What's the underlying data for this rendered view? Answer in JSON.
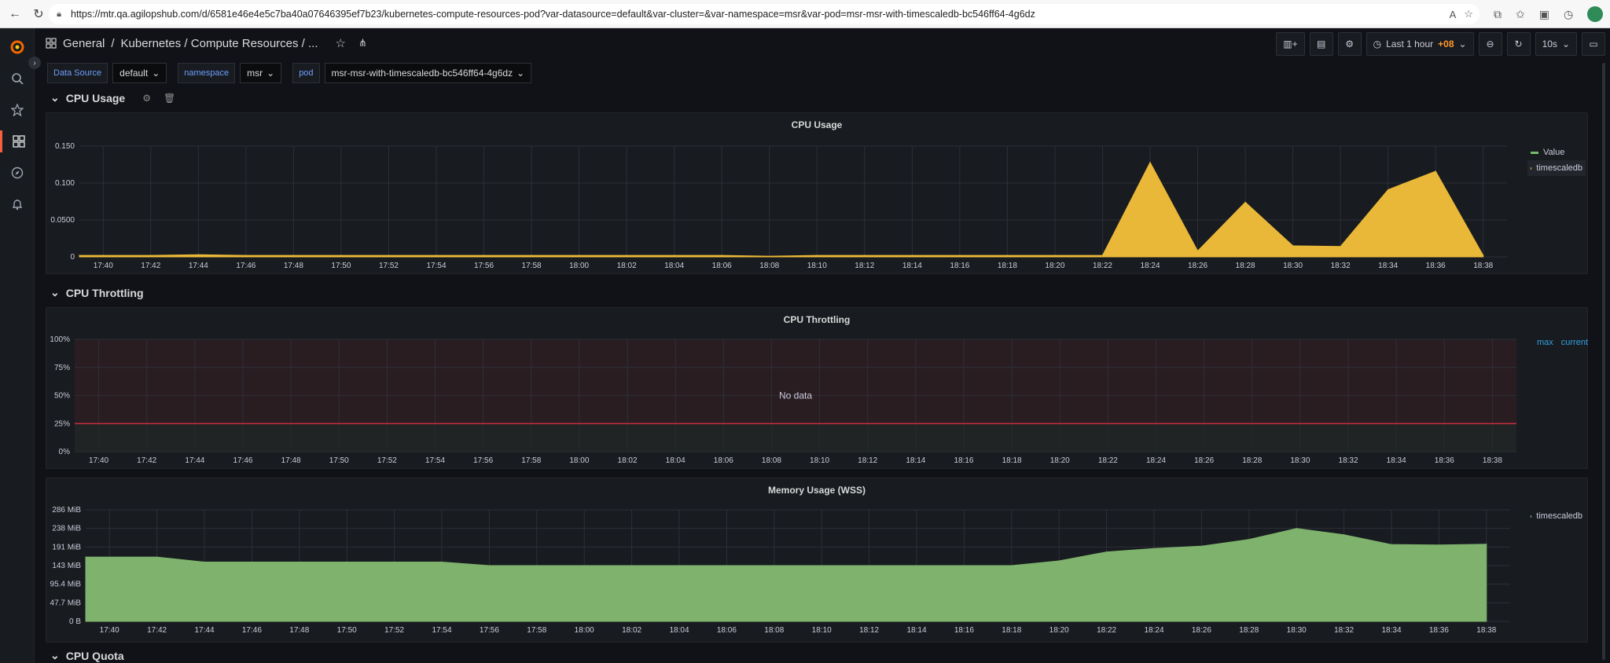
{
  "browser": {
    "url": "https://mtr.qa.agilopshub.com/d/6581e46e4e5c7ba40a07646395ef7b23/kubernetes-compute-resources-pod?var-datasource=default&var-cluster=&var-namespace=msr&var-pod=msr-msr-with-timescaledb-bc546ff64-4g6dz"
  },
  "breadcrumb": {
    "folder": "General",
    "separator": "/",
    "title": "Kubernetes / Compute Resources / ..."
  },
  "toolbar": {
    "time_range": "Last 1 hour",
    "timezone": "+08",
    "refresh": "10s"
  },
  "variables": [
    {
      "label": "Data Source",
      "value": "default"
    },
    {
      "label": "namespace",
      "value": "msr"
    },
    {
      "label": "pod",
      "value": "msr-msr-with-timescaledb-bc546ff64-4g6dz"
    }
  ],
  "rows": {
    "cpu_usage": "CPU Usage",
    "cpu_throttling": "CPU Throttling",
    "cpu_quota": "CPU Quota"
  },
  "colors": {
    "timescaledb_cpu": "#eab839",
    "value_series": "#73bf69",
    "memory": "#7eb26d",
    "threshold": "#e02f44",
    "legend_head": "#33a2e5"
  },
  "chart_data": [
    {
      "type": "area",
      "title": "CPU Usage",
      "x": [
        "17:39",
        "17:40",
        "17:42",
        "17:44",
        "17:46",
        "17:48",
        "17:50",
        "17:52",
        "17:54",
        "17:56",
        "17:58",
        "18:00",
        "18:02",
        "18:04",
        "18:06",
        "18:08",
        "18:10",
        "18:12",
        "18:14",
        "18:16",
        "18:18",
        "18:20",
        "18:22",
        "18:24",
        "18:26",
        "18:28",
        "18:30",
        "18:32",
        "18:34",
        "18:36",
        "18:38"
      ],
      "x_ticks": [
        "17:40",
        "17:42",
        "17:44",
        "17:46",
        "17:48",
        "17:50",
        "17:52",
        "17:54",
        "17:56",
        "17:58",
        "18:00",
        "18:02",
        "18:04",
        "18:06",
        "18:08",
        "18:10",
        "18:12",
        "18:14",
        "18:16",
        "18:18",
        "18:20",
        "18:22",
        "18:24",
        "18:26",
        "18:28",
        "18:30",
        "18:32",
        "18:34",
        "18:36",
        "18:38"
      ],
      "series": [
        {
          "name": "Value",
          "values": []
        },
        {
          "name": "timescaledb",
          "values": [
            0.002,
            0.002,
            0.002,
            0.003,
            0.002,
            0.002,
            0.002,
            0.002,
            0.002,
            0.002,
            0.002,
            0.002,
            0.002,
            0.002,
            0.002,
            0.001,
            0.002,
            0.002,
            0.002,
            0.002,
            0.002,
            0.002,
            0.002,
            0.128,
            0.008,
            0.074,
            0.015,
            0.014,
            0.091,
            0.116,
            0.002
          ]
        }
      ],
      "y_ticks": [
        "0",
        "0.0500",
        "0.100",
        "0.150"
      ],
      "ylim": [
        0,
        0.15
      ],
      "legend": "right"
    },
    {
      "type": "line",
      "title": "CPU Throttling",
      "x_ticks": [
        "17:40",
        "17:42",
        "17:44",
        "17:46",
        "17:48",
        "17:50",
        "17:52",
        "17:54",
        "17:56",
        "17:58",
        "18:00",
        "18:02",
        "18:04",
        "18:06",
        "18:08",
        "18:10",
        "18:12",
        "18:14",
        "18:16",
        "18:18",
        "18:20",
        "18:22",
        "18:24",
        "18:26",
        "18:28",
        "18:30",
        "18:32",
        "18:34",
        "18:36",
        "18:38"
      ],
      "y_ticks": [
        "0%",
        "25%",
        "50%",
        "75%",
        "100%"
      ],
      "ylim": [
        0,
        100
      ],
      "threshold": 25,
      "no_data": "No data",
      "legend_columns": [
        "max",
        "current"
      ]
    },
    {
      "type": "area",
      "title": "Memory Usage (WSS)",
      "x": [
        "17:39",
        "17:42",
        "17:44",
        "17:46",
        "17:48",
        "17:50",
        "17:52",
        "17:54",
        "17:56",
        "17:58",
        "18:00",
        "18:02",
        "18:04",
        "18:06",
        "18:08",
        "18:10",
        "18:12",
        "18:14",
        "18:16",
        "18:18",
        "18:20",
        "18:22",
        "18:24",
        "18:26",
        "18:28",
        "18:30",
        "18:32",
        "18:34",
        "18:36",
        "18:38"
      ],
      "x_ticks": [
        "17:40",
        "17:42",
        "17:44",
        "17:46",
        "17:48",
        "17:50",
        "17:52",
        "17:54",
        "17:56",
        "17:58",
        "18:00",
        "18:02",
        "18:04",
        "18:06",
        "18:08",
        "18:10",
        "18:12",
        "18:14",
        "18:16",
        "18:18",
        "18:20",
        "18:22",
        "18:24",
        "18:26",
        "18:28",
        "18:30",
        "18:32",
        "18:34",
        "18:36",
        "18:38"
      ],
      "series": [
        {
          "name": "timescaledb",
          "values": [
            165,
            165,
            152,
            152,
            152,
            152,
            152,
            152,
            143,
            143,
            143,
            143,
            143,
            143,
            143,
            143,
            143,
            143,
            143,
            143,
            155,
            178,
            187,
            193,
            210,
            238,
            222,
            197,
            196,
            198
          ]
        }
      ],
      "y_ticks": [
        "0 B",
        "47.7 MiB",
        "95.4 MiB",
        "143 MiB",
        "191 MiB",
        "238 MiB",
        "286 MiB"
      ],
      "ylim": [
        0,
        286
      ],
      "legend": "right"
    }
  ]
}
